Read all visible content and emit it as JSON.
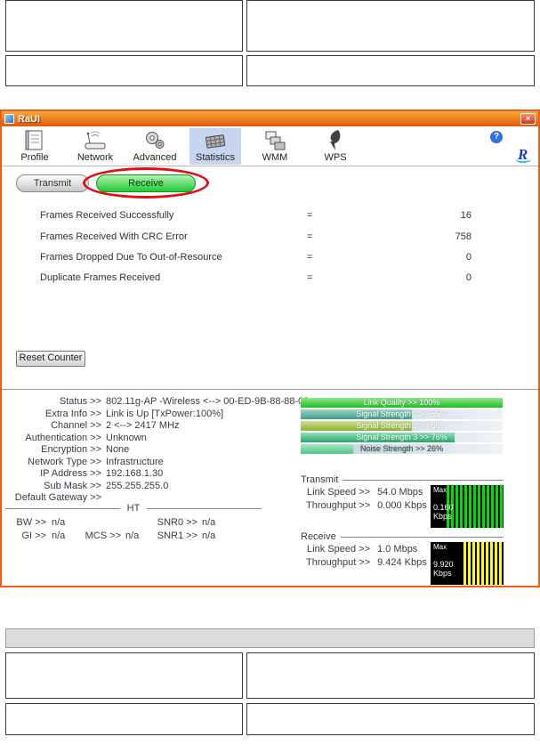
{
  "app": {
    "title": "RaUI",
    "close_icon": "×",
    "toolbar": {
      "items": [
        {
          "label": "Profile",
          "icon": "profile-icon"
        },
        {
          "label": "Network",
          "icon": "network-icon"
        },
        {
          "label": "Advanced",
          "icon": "advanced-icon"
        },
        {
          "label": "Statistics",
          "icon": "statistics-icon"
        },
        {
          "label": "WMM",
          "icon": "wmm-icon"
        },
        {
          "label": "WPS",
          "icon": "wps-icon"
        }
      ],
      "active_item": "Statistics",
      "help_icon": "?",
      "brand": "R"
    },
    "tabs": {
      "transmit": "Transmit",
      "receive": "Receive",
      "active": "Receive"
    },
    "statistics": {
      "rows": [
        {
          "label": "Frames Received Successfully",
          "eq": "=",
          "value": "16"
        },
        {
          "label": "Frames Received With CRC Error",
          "eq": "=",
          "value": "758"
        },
        {
          "label": "Frames Dropped Due To Out-of-Resource",
          "eq": "=",
          "value": "0"
        },
        {
          "label": "Duplicate Frames Received",
          "eq": "=",
          "value": "0"
        }
      ],
      "reset_button": "Reset Counter"
    },
    "status_panel": {
      "rows": [
        {
          "label": "Status >>",
          "value": "802.11g-AP -Wireless  <--> 00-ED-9B-88-88-02"
        },
        {
          "label": "Extra Info >>",
          "value": "Link is Up [TxPower:100%]"
        },
        {
          "label": "Channel >>",
          "value": "2 <--> 2417 MHz"
        },
        {
          "label": "Authentication >>",
          "value": "Unknown"
        },
        {
          "label": "Encryption >>",
          "value": "None"
        },
        {
          "label": "Network Type >>",
          "value": "Infrastructure"
        },
        {
          "label": "IP Address >>",
          "value": "192.168.1.30"
        },
        {
          "label": "Sub Mask >>",
          "value": "255.255.255.0"
        },
        {
          "label": "Default Gateway >>",
          "value": ""
        }
      ],
      "ht": {
        "title": "HT",
        "bw_label": "BW >>",
        "bw_value": "n/a",
        "gi_label": "GI >>",
        "gi_value": "n/a",
        "mcs_label": "MCS >>",
        "mcs_value": "n/a",
        "snr0_label": "SNR0 >>",
        "snr0_value": "n/a",
        "snr1_label": "SNR1 >>",
        "snr1_value": "n/a"
      }
    },
    "quality_bars": [
      {
        "text": "Link Quality >> 100%",
        "percent": 100,
        "fill_from": "#8ce68c",
        "fill_to": "#1fbf1f",
        "text_color": "#ffffff"
      },
      {
        "text": "Signal Strength 1 >> 55%",
        "percent": 55,
        "fill_from": "#9fd4c4",
        "fill_to": "#3f9f8a",
        "text_color": "#ffffff"
      },
      {
        "text": "Signal Strength 2 >> 55%",
        "percent": 55,
        "fill_from": "#cfe09a",
        "fill_to": "#8fb32e",
        "text_color": "#ffffff"
      },
      {
        "text": "Signal Strength 3 >> 76%",
        "percent": 76,
        "fill_from": "#8fe0b8",
        "fill_to": "#27a969",
        "text_color": "#ffffff"
      },
      {
        "text": "Noise Strength >> 26%",
        "percent": 26,
        "fill_from": "#a8e6c4",
        "fill_to": "#54c68c",
        "text_color": "#2a4a3a"
      }
    ],
    "transmit_panel": {
      "title": "Transmit",
      "link_speed_label": "Link Speed >>",
      "link_speed_value": "54.0 Mbps",
      "throughput_label": "Throughput >>",
      "throughput_value": "0.000 Kbps",
      "chart": {
        "max_label": "Max",
        "value": "0.160",
        "unit": "Kbps",
        "bar_color": "#00dd00",
        "fill_percent": 78
      }
    },
    "receive_panel": {
      "title": "Receive",
      "link_speed_label": "Link Speed >>",
      "link_speed_value": "1.0 Mbps",
      "throughput_label": "Throughput >>",
      "throughput_value": "9.424 Kbps",
      "chart": {
        "max_label": "Max",
        "value": "9.920",
        "unit": "Kbps",
        "bar_color": "#ffff00",
        "fill_percent": 55
      }
    },
    "accent_colors": {
      "window_border": "#e8601c",
      "titlebar_from": "#f9a93a",
      "titlebar_to": "#e05a08",
      "annotation_red": "#dd1111",
      "receive_tab_green": "#1fca35",
      "statistics_highlight": "#c7d5f1"
    }
  }
}
